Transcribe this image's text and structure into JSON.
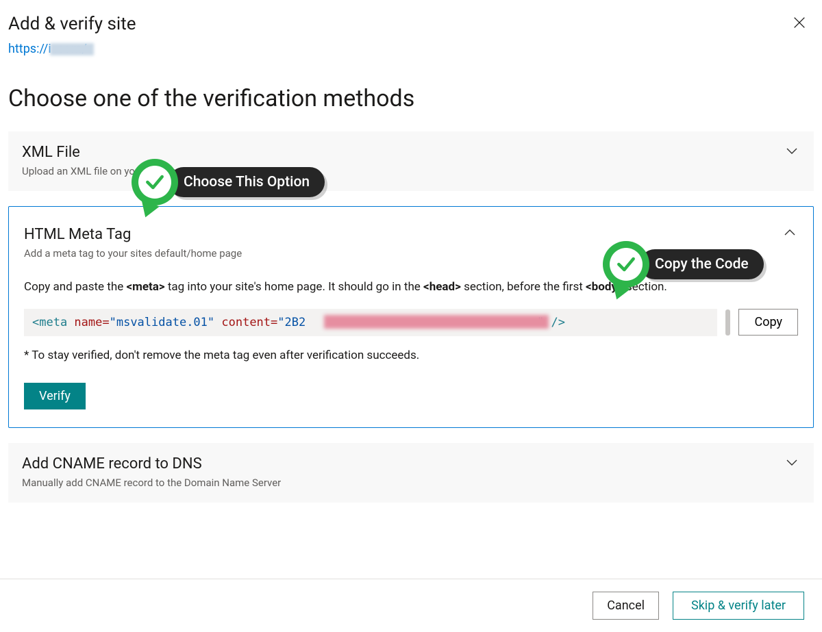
{
  "header": {
    "title": "Add & verify site",
    "site_url": "https://i            .com/"
  },
  "section_title": "Choose one of the verification methods",
  "panels": {
    "xml": {
      "title": "XML File",
      "subtitle": "Upload an XML file on your        server"
    },
    "meta": {
      "title": "HTML Meta Tag",
      "subtitle": "Add a meta tag to your sites default/home page",
      "instruction_pre": "Copy and paste the ",
      "instruction_b1": "<meta>",
      "instruction_mid": " tag into your site's home page. It should go in the ",
      "instruction_b2": "<head>",
      "instruction_mid2": " section, before the first ",
      "instruction_b3": "<body>",
      "instruction_post": " section.",
      "code_raw": "<meta name=\"msvalidate.01\" content=\"2B2████████████████████████████████\" />",
      "code_tag_open": "<meta",
      "code_attr_name": " name=",
      "code_val_name": "\"msvalidate.01\"",
      "code_attr_content": " content=",
      "code_val_content_prefix": "\"2B2",
      "code_val_content_suffix": "\"",
      "code_tag_close": " />",
      "copy_label": "Copy",
      "note": "* To stay verified, don't remove the meta tag even after verification succeeds.",
      "verify_label": "Verify"
    },
    "cname": {
      "title": "Add CNAME record to DNS",
      "subtitle": "Manually add CNAME record to the Domain Name Server"
    }
  },
  "callouts": {
    "choose": "Choose This Option",
    "copy": "Copy the Code"
  },
  "footer": {
    "cancel": "Cancel",
    "skip": "Skip & verify later"
  }
}
